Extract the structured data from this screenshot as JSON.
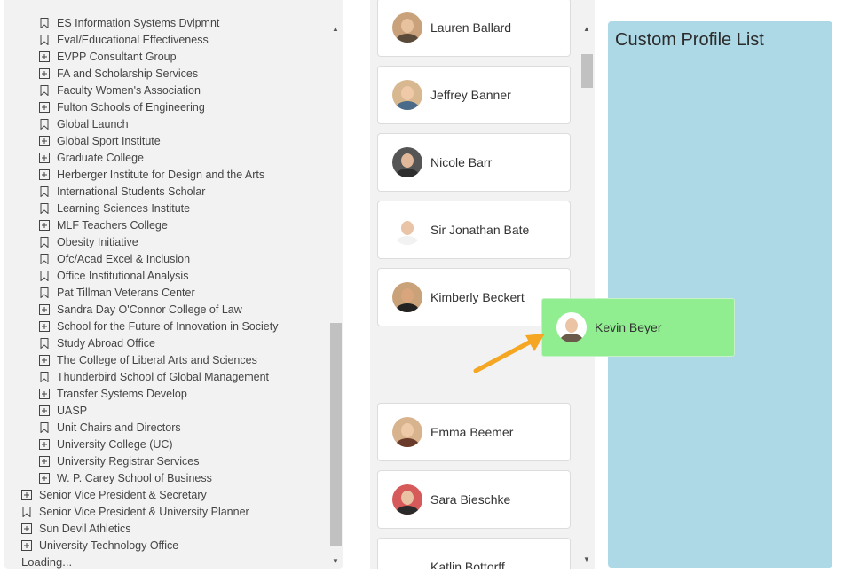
{
  "tree": {
    "items": [
      {
        "label": "ES Information Systems Dvlpmnt",
        "icon": "bookmark-icon",
        "level": 2
      },
      {
        "label": "Eval/Educational Effectiveness",
        "icon": "bookmark-icon",
        "level": 2
      },
      {
        "label": "EVPP Consultant Group",
        "icon": "expand-icon",
        "level": 2
      },
      {
        "label": "FA and Scholarship Services",
        "icon": "expand-icon",
        "level": 2
      },
      {
        "label": "Faculty Women's Association",
        "icon": "bookmark-icon",
        "level": 2
      },
      {
        "label": "Fulton Schools of Engineering",
        "icon": "expand-icon",
        "level": 2
      },
      {
        "label": "Global Launch",
        "icon": "bookmark-icon",
        "level": 2
      },
      {
        "label": "Global Sport Institute",
        "icon": "expand-icon",
        "level": 2
      },
      {
        "label": "Graduate College",
        "icon": "expand-icon",
        "level": 2
      },
      {
        "label": "Herberger Institute for Design and the Arts",
        "icon": "expand-icon",
        "level": 2
      },
      {
        "label": "International Students Scholar",
        "icon": "bookmark-icon",
        "level": 2
      },
      {
        "label": "Learning Sciences Institute",
        "icon": "bookmark-icon",
        "level": 2
      },
      {
        "label": "MLF Teachers College",
        "icon": "expand-icon",
        "level": 2
      },
      {
        "label": "Obesity Initiative",
        "icon": "bookmark-icon",
        "level": 2
      },
      {
        "label": "Ofc/Acad Excel & Inclusion",
        "icon": "bookmark-icon",
        "level": 2
      },
      {
        "label": "Office Institutional Analysis",
        "icon": "bookmark-icon",
        "level": 2
      },
      {
        "label": "Pat Tillman Veterans Center",
        "icon": "bookmark-icon",
        "level": 2
      },
      {
        "label": "Sandra Day O'Connor College of Law",
        "icon": "expand-icon",
        "level": 2
      },
      {
        "label": "School for the Future of Innovation in Society",
        "icon": "expand-icon",
        "level": 2
      },
      {
        "label": "Study Abroad Office",
        "icon": "bookmark-icon",
        "level": 2
      },
      {
        "label": "The College of Liberal Arts and Sciences",
        "icon": "expand-icon",
        "level": 2
      },
      {
        "label": "Thunderbird School of Global Management",
        "icon": "bookmark-icon",
        "level": 2
      },
      {
        "label": "Transfer Systems Develop",
        "icon": "expand-icon",
        "level": 2
      },
      {
        "label": "UASP",
        "icon": "expand-icon",
        "level": 2
      },
      {
        "label": "Unit Chairs and Directors",
        "icon": "bookmark-icon",
        "level": 2
      },
      {
        "label": "University College (UC)",
        "icon": "expand-icon",
        "level": 2
      },
      {
        "label": "University Registrar Services",
        "icon": "expand-icon",
        "level": 2
      },
      {
        "label": "W. P. Carey School of Business",
        "icon": "expand-icon",
        "level": 2
      },
      {
        "label": "Senior Vice President & Secretary",
        "icon": "expand-icon",
        "level": 1
      },
      {
        "label": "Senior Vice President & University Planner",
        "icon": "bookmark-icon",
        "level": 1
      },
      {
        "label": "Sun Devil Athletics",
        "icon": "expand-icon",
        "level": 1
      },
      {
        "label": "University Technology Office",
        "icon": "expand-icon",
        "level": 1
      }
    ],
    "loading_label": "Loading..."
  },
  "people": [
    {
      "name": "Lauren Ballard",
      "skin": "#e8c29e",
      "shirt": "#5a4a3a",
      "bg": "#c9a27c"
    },
    {
      "name": "Jeffrey Banner",
      "skin": "#f0c9a8",
      "shirt": "#4a6a8a",
      "bg": "#d8b890"
    },
    {
      "name": "Nicole Barr",
      "skin": "#e2b89a",
      "shirt": "#2e2e2e",
      "bg": "#555555"
    },
    {
      "name": "Sir Jonathan Bate",
      "skin": "#e9c4a6",
      "shirt": "#f2f2f2",
      "bg": "#ffffff"
    },
    {
      "name": "Kimberly Beckert",
      "skin": "#d9a57c",
      "shirt": "#222222",
      "bg": "#caa27a"
    },
    {
      "name": "Emma Beemer",
      "skin": "#efcaa9",
      "shirt": "#6a3a2a",
      "bg": "#d8b48e"
    },
    {
      "name": "Sara Bieschke",
      "skin": "#e8c2a2",
      "shirt": "#2a2a2a",
      "bg": "#d65a5a"
    },
    {
      "name": "Katlin Bottorff",
      "skin": "#ffffff",
      "shirt": "#ffffff",
      "bg": "#ffffff"
    }
  ],
  "custom_list": {
    "title": "Custom Profile List"
  },
  "dragging": {
    "name": "Kevin Beyer",
    "skin": "#eac4a4",
    "shirt": "#6a5a4a",
    "bg": "#ffffff"
  },
  "colors": {
    "drop_zone": "#add8e6",
    "drag_card": "#90ee90",
    "arrow": "#f5a623"
  }
}
